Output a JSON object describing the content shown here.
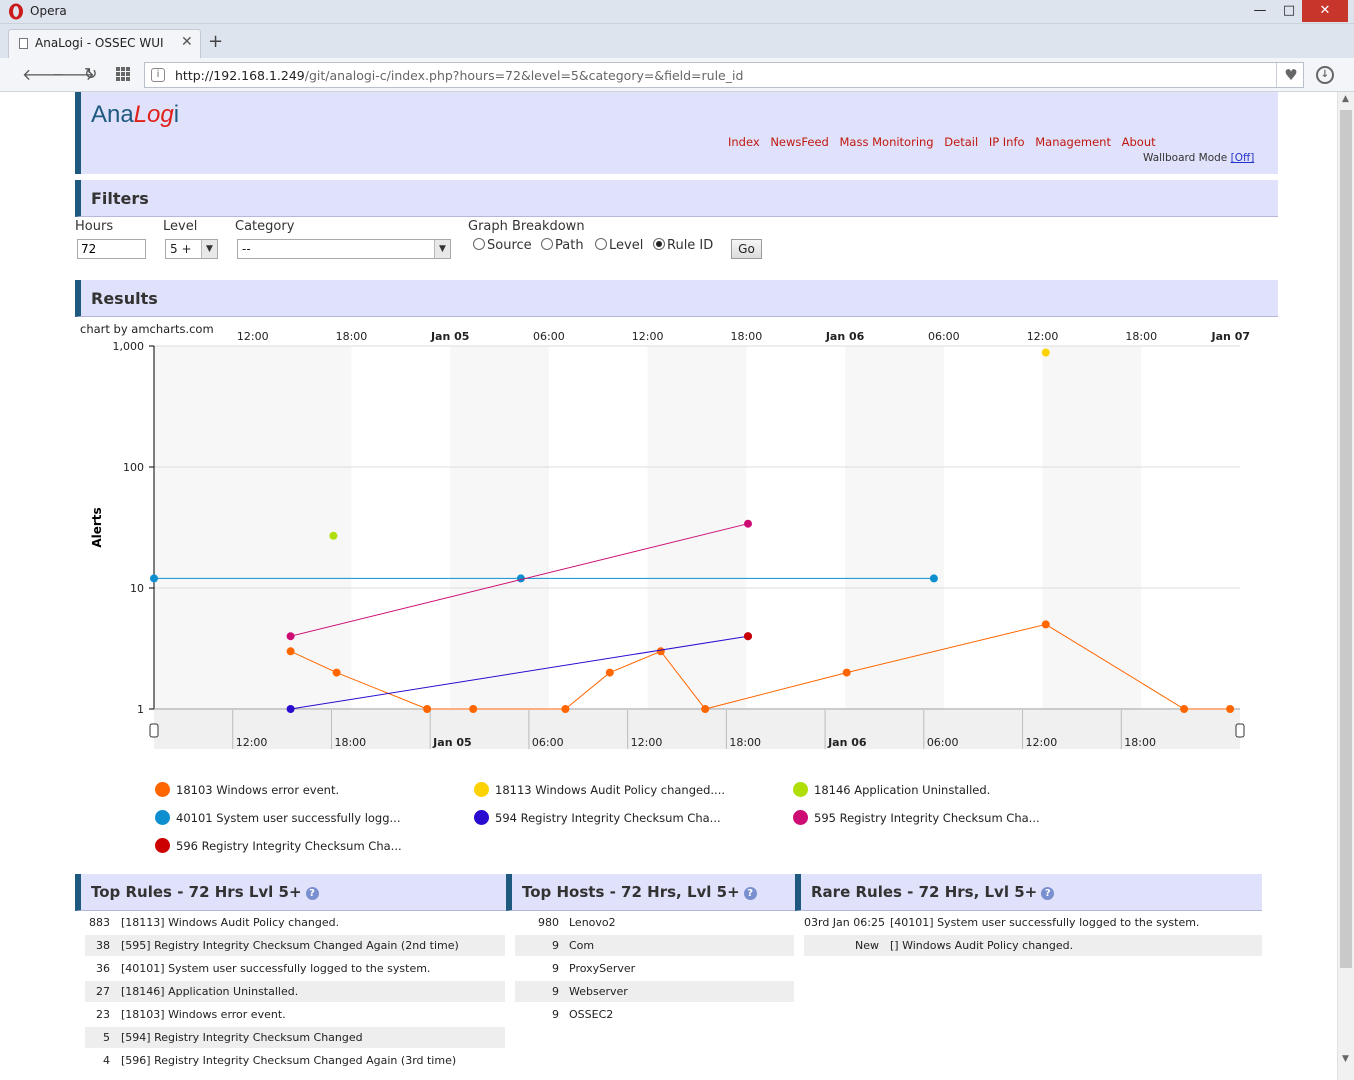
{
  "browser": {
    "app_name": "Opera",
    "tab_title": "AnaLogi - OSSEC WUI",
    "url_host": "http://192.168.1.249",
    "url_rest": "/git/analogi-c/index.php?hours=72&level=5&category=&field=rule_id"
  },
  "header": {
    "logo_ana": "Ana",
    "logo_log": "Log",
    "logo_i": "i",
    "nav": [
      "Index",
      "NewsFeed",
      "Mass Monitoring",
      "Detail",
      "IP Info",
      "Management",
      "About"
    ],
    "wallboard_label": "Wallboard Mode",
    "wallboard_toggle": "[Off]"
  },
  "filters": {
    "title": "Filters",
    "hours_label": "Hours",
    "hours_value": "72",
    "level_label": "Level",
    "level_value": "5 +",
    "category_label": "Category",
    "category_value": "--",
    "breakdown_label": "Graph Breakdown",
    "breakdown_options": [
      "Source",
      "Path",
      "Level",
      "Rule ID"
    ],
    "breakdown_selected": "Rule ID",
    "go_label": "Go"
  },
  "results": {
    "title": "Results",
    "chart_credit": "chart by amcharts.com"
  },
  "chart_data": {
    "type": "line",
    "x_scale": "time",
    "x_range": [
      "Jan 04 06:00",
      "Jan 07 00:00"
    ],
    "y_scale": "log",
    "ylabel": "Alerts",
    "ylim": [
      1,
      1000
    ],
    "y_ticks": [
      "1",
      "10",
      "100",
      "1,000"
    ],
    "x_ticks": [
      {
        "label": "12:00",
        "hour": 12,
        "bold": false
      },
      {
        "label": "18:00",
        "hour": 18,
        "bold": false
      },
      {
        "label": "Jan 05",
        "hour": 24,
        "bold": true
      },
      {
        "label": "06:00",
        "hour": 30,
        "bold": false
      },
      {
        "label": "12:00",
        "hour": 36,
        "bold": false
      },
      {
        "label": "18:00",
        "hour": 42,
        "bold": false
      },
      {
        "label": "Jan 06",
        "hour": 48,
        "bold": true
      },
      {
        "label": "06:00",
        "hour": 54,
        "bold": false
      },
      {
        "label": "12:00",
        "hour": 60,
        "bold": false
      },
      {
        "label": "18:00",
        "hour": 66,
        "bold": false
      },
      {
        "label": "Jan 07",
        "hour": 72,
        "bold": true
      }
    ],
    "scroll_ticks": [
      {
        "label": "12:00",
        "hour": 12,
        "bold": false
      },
      {
        "label": "18:00",
        "hour": 18,
        "bold": false
      },
      {
        "label": "Jan 05",
        "hour": 24,
        "bold": true
      },
      {
        "label": "06:00",
        "hour": 30,
        "bold": false
      },
      {
        "label": "12:00",
        "hour": 36,
        "bold": false
      },
      {
        "label": "18:00",
        "hour": 42,
        "bold": false
      },
      {
        "label": "Jan 06",
        "hour": 48,
        "bold": true
      },
      {
        "label": "06:00",
        "hour": 54,
        "bold": false
      },
      {
        "label": "12:00",
        "hour": 60,
        "bold": false
      },
      {
        "label": "18:00",
        "hour": 66,
        "bold": false
      }
    ],
    "series": [
      {
        "name": "18103 Windows error event.",
        "color": "#ff6600",
        "points": [
          [
            14.3,
            3
          ],
          [
            17.1,
            2
          ],
          [
            22.6,
            1
          ],
          [
            25.4,
            1
          ],
          [
            31,
            1
          ],
          [
            33.7,
            2
          ],
          [
            36.8,
            3
          ],
          [
            39.5,
            1
          ],
          [
            48.1,
            2
          ],
          [
            60.2,
            5
          ],
          [
            68.6,
            1
          ],
          [
            71.4,
            1
          ]
        ]
      },
      {
        "name": "18113 Windows Audit Policy changed....",
        "color": "#fcd202",
        "points": [
          [
            60.2,
            883
          ]
        ]
      },
      {
        "name": "18146 Application Uninstalled.",
        "color": "#b0de09",
        "points": [
          [
            16.9,
            27
          ]
        ]
      },
      {
        "name": "40101 System user successfully logg...",
        "color": "#0d8ecf",
        "points": [
          [
            6,
            12
          ],
          [
            28.3,
            12
          ],
          [
            53.4,
            12
          ]
        ]
      },
      {
        "name": "594 Registry Integrity Checksum Cha...",
        "color": "#2a0cd0",
        "points": [
          [
            14.3,
            1
          ],
          [
            42.1,
            4
          ]
        ]
      },
      {
        "name": "595 Registry Integrity Checksum Cha...",
        "color": "#cd0d74",
        "points": [
          [
            14.3,
            4
          ],
          [
            42.1,
            34
          ]
        ]
      },
      {
        "name": "596 Registry Integrity Checksum Cha...",
        "color": "#cc0000",
        "points": [
          [
            42.1,
            4
          ]
        ]
      }
    ]
  },
  "top_rules": {
    "title": "Top Rules - 72 Hrs Lvl 5+",
    "rows": [
      {
        "count": "883",
        "text": "[18113] Windows Audit Policy changed."
      },
      {
        "count": "38",
        "text": "[595] Registry Integrity Checksum Changed Again (2nd time)"
      },
      {
        "count": "36",
        "text": "[40101] System user successfully logged to the system."
      },
      {
        "count": "27",
        "text": "[18146] Application Uninstalled."
      },
      {
        "count": "23",
        "text": "[18103] Windows error event."
      },
      {
        "count": "5",
        "text": "[594] Registry Integrity Checksum Changed"
      },
      {
        "count": "4",
        "text": "[596] Registry Integrity Checksum Changed Again (3rd time)"
      }
    ]
  },
  "top_hosts": {
    "title": "Top Hosts - 72 Hrs, Lvl 5+",
    "rows": [
      {
        "count": "980",
        "text": "Lenovo2"
      },
      {
        "count": "9",
        "text": "Com"
      },
      {
        "count": "9",
        "text": "ProxyServer"
      },
      {
        "count": "9",
        "text": "Webserver"
      },
      {
        "count": "9",
        "text": "OSSEC2"
      }
    ]
  },
  "rare_rules": {
    "title": "Rare Rules - 72 Hrs, Lvl 5+",
    "rows": [
      {
        "when": "03rd Jan 06:25",
        "text": "[40101] System user successfully logged to the system."
      },
      {
        "when": "New",
        "text": "[] Windows Audit Policy changed."
      }
    ]
  }
}
